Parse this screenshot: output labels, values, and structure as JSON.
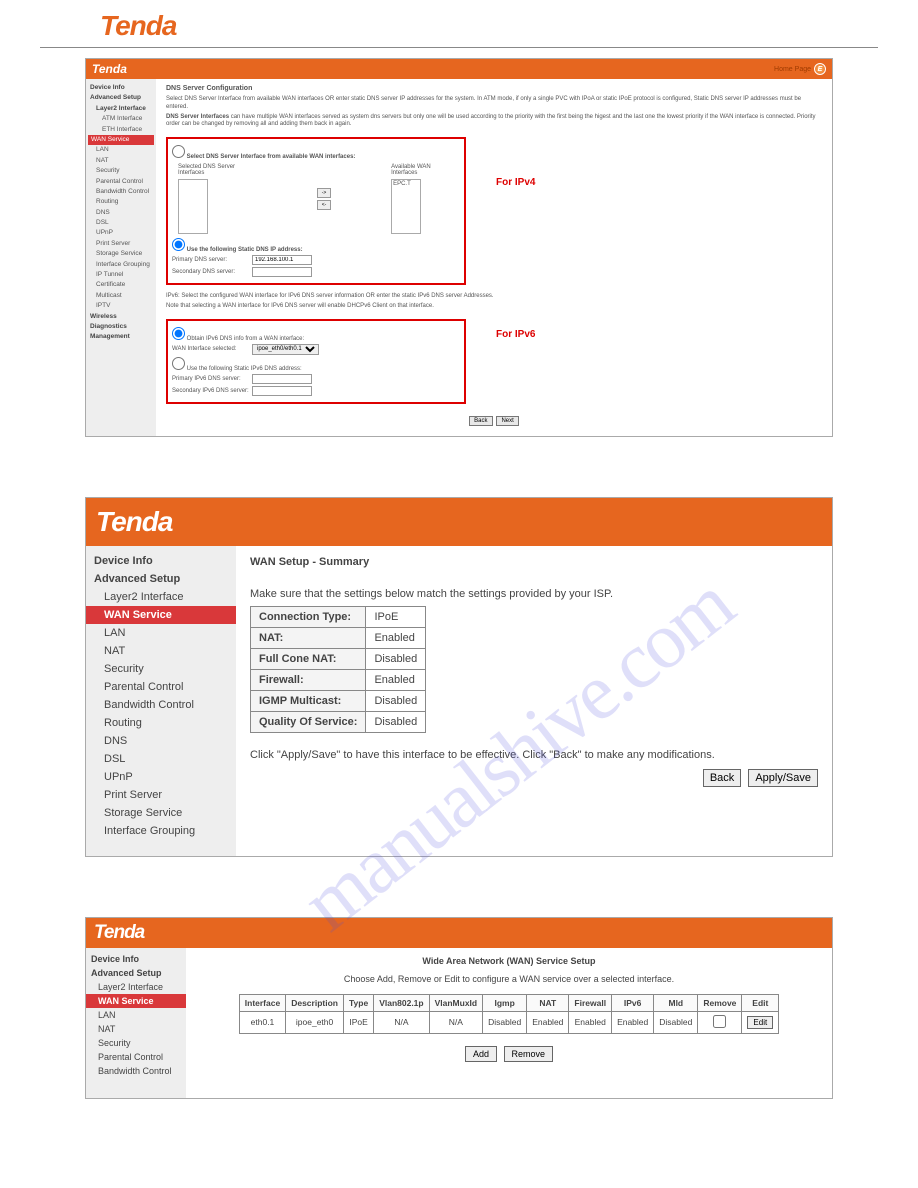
{
  "logo": "Tenda",
  "watermark": "manualshive.com",
  "home_text": "Home Page",
  "shot1": {
    "nav": [
      "Device Info",
      "Advanced Setup",
      "Layer2 Interface",
      "ATM Interface",
      "ETH Interface",
      "WAN Service",
      "LAN",
      "NAT",
      "Security",
      "Parental Control",
      "Bandwidth Control",
      "Routing",
      "DNS",
      "DSL",
      "UPnP",
      "Print Server",
      "Storage Service",
      "Interface Grouping",
      "IP Tunnel",
      "Certificate",
      "Multicast",
      "IPTV",
      "Wireless",
      "Diagnostics",
      "Management"
    ],
    "title": "DNS Server Configuration",
    "p1": "Select DNS Server Interface from available WAN interfaces OR enter static DNS server IP addresses for the system. In ATM mode, if only a single PVC with IPoA or static IPoE protocol is configured, Static DNS server IP addresses must be entered.",
    "p2a": "DNS Server Interfaces",
    "p2b": " can have multiple WAN interfaces served as system dns servers but only one will be used according to the priority with the first being the higest and the last one the lowest priority if the WAN interface is connected. Priority order can be changed by removing all and adding them back in again.",
    "radio1": "Select DNS Server Interface from available WAN interfaces:",
    "selected_label": "Selected DNS Server Interfaces",
    "available_label": "Available WAN Interfaces",
    "avail_item": "EPC.T",
    "btn_left": "<-",
    "btn_right": "->",
    "radio2": "Use the following Static DNS IP address:",
    "primary_dns_label": "Primary DNS server:",
    "primary_dns_value": "192.168.100.1",
    "secondary_dns_label": "Secondary DNS server:",
    "ipv6_p1": "IPv6: Select the configured WAN interface for IPv6 DNS server information OR enter the static IPv6 DNS server Addresses.",
    "ipv6_p2": "Note that selecting a WAN interface for IPv6 DNS server will enable DHCPv6 Client on that interface.",
    "radio3": "Obtain IPv6 DNS info from a WAN interface:",
    "wan_if_label": "WAN Interface selected:",
    "wan_if_value": "ipoe_eth0/eth0.1",
    "radio4": "Use the following Static IPv6 DNS address:",
    "primary6_label": "Primary IPv6 DNS server:",
    "secondary6_label": "Secondary IPv6 DNS server:",
    "for_ipv4": "For IPv4",
    "for_ipv6": "For IPv6",
    "back": "Back",
    "next": "Next"
  },
  "shot2": {
    "nav": [
      "Device Info",
      "Advanced Setup",
      "Layer2 Interface",
      "WAN Service",
      "LAN",
      "NAT",
      "Security",
      "Parental Control",
      "Bandwidth Control",
      "Routing",
      "DNS",
      "DSL",
      "UPnP",
      "Print Server",
      "Storage Service",
      "Interface Grouping"
    ],
    "title": "WAN Setup - Summary",
    "p1": "Make sure that the settings below match the settings provided by your ISP.",
    "rows": [
      [
        "Connection Type:",
        "IPoE"
      ],
      [
        "NAT:",
        "Enabled"
      ],
      [
        "Full Cone NAT:",
        "Disabled"
      ],
      [
        "Firewall:",
        "Enabled"
      ],
      [
        "IGMP Multicast:",
        "Disabled"
      ],
      [
        "Quality Of Service:",
        "Disabled"
      ]
    ],
    "p2": "Click \"Apply/Save\" to have this interface to be effective. Click \"Back\" to make any modifications.",
    "back": "Back",
    "apply": "Apply/Save"
  },
  "shot3": {
    "nav": [
      "Device Info",
      "Advanced Setup",
      "Layer2 Interface",
      "WAN Service",
      "LAN",
      "NAT",
      "Security",
      "Parental Control",
      "Bandwidth Control"
    ],
    "title": "Wide Area Network (WAN) Service Setup",
    "sub": "Choose Add, Remove or Edit to configure a WAN service over a selected interface.",
    "headers": [
      "Interface",
      "Description",
      "Type",
      "Vlan802.1p",
      "VlanMuxId",
      "Igmp",
      "NAT",
      "Firewall",
      "IPv6",
      "Mld",
      "Remove",
      "Edit"
    ],
    "row": [
      "eth0.1",
      "ipoe_eth0",
      "IPoE",
      "N/A",
      "N/A",
      "Disabled",
      "Enabled",
      "Enabled",
      "Enabled",
      "Disabled"
    ],
    "edit": "Edit",
    "add": "Add",
    "remove": "Remove"
  }
}
